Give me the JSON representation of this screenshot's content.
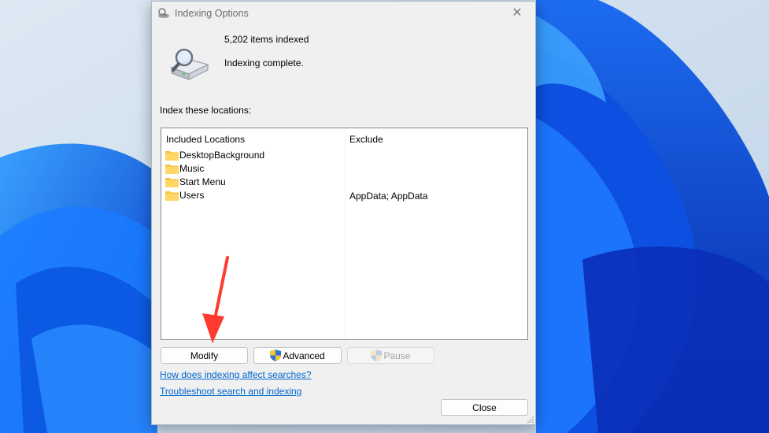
{
  "dialog": {
    "title": "Indexing Options",
    "items_indexed": "5,202 items indexed",
    "status": "Indexing complete.",
    "section_label": "Index these locations:",
    "columns": {
      "included": "Included Locations",
      "exclude": "Exclude"
    },
    "locations": [
      {
        "name": "DesktopBackground",
        "exclude": ""
      },
      {
        "name": "Music",
        "exclude": ""
      },
      {
        "name": "Start Menu",
        "exclude": ""
      },
      {
        "name": "Users",
        "exclude": "AppData; AppData"
      }
    ],
    "buttons": {
      "modify": "Modify",
      "advanced": "Advanced",
      "pause": "Pause",
      "close": "Close"
    },
    "links": {
      "how_indexing": "How does indexing affect searches?",
      "troubleshoot": "Troubleshoot search and indexing"
    }
  },
  "colors": {
    "annotation_arrow": "#ff3b30",
    "link": "#0066cc",
    "folder": "#f6c443"
  }
}
